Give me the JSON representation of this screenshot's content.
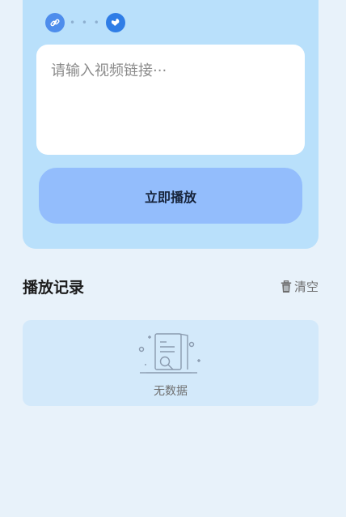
{
  "input": {
    "placeholder": "请输入视频链接···"
  },
  "play_button": {
    "label": "立即播放"
  },
  "history": {
    "title": "播放记录",
    "clear_label": "清空",
    "empty_text": "无数据"
  },
  "icons": {
    "link": "link-icon",
    "globe": "globe-icon",
    "trash": "trash-icon",
    "empty_state": "document-search-icon"
  },
  "colors": {
    "page_bg": "#e8f2fa",
    "card_bg": "#b9e0fb",
    "button_bg": "#93bdfc",
    "accent": "#2f7de6"
  }
}
